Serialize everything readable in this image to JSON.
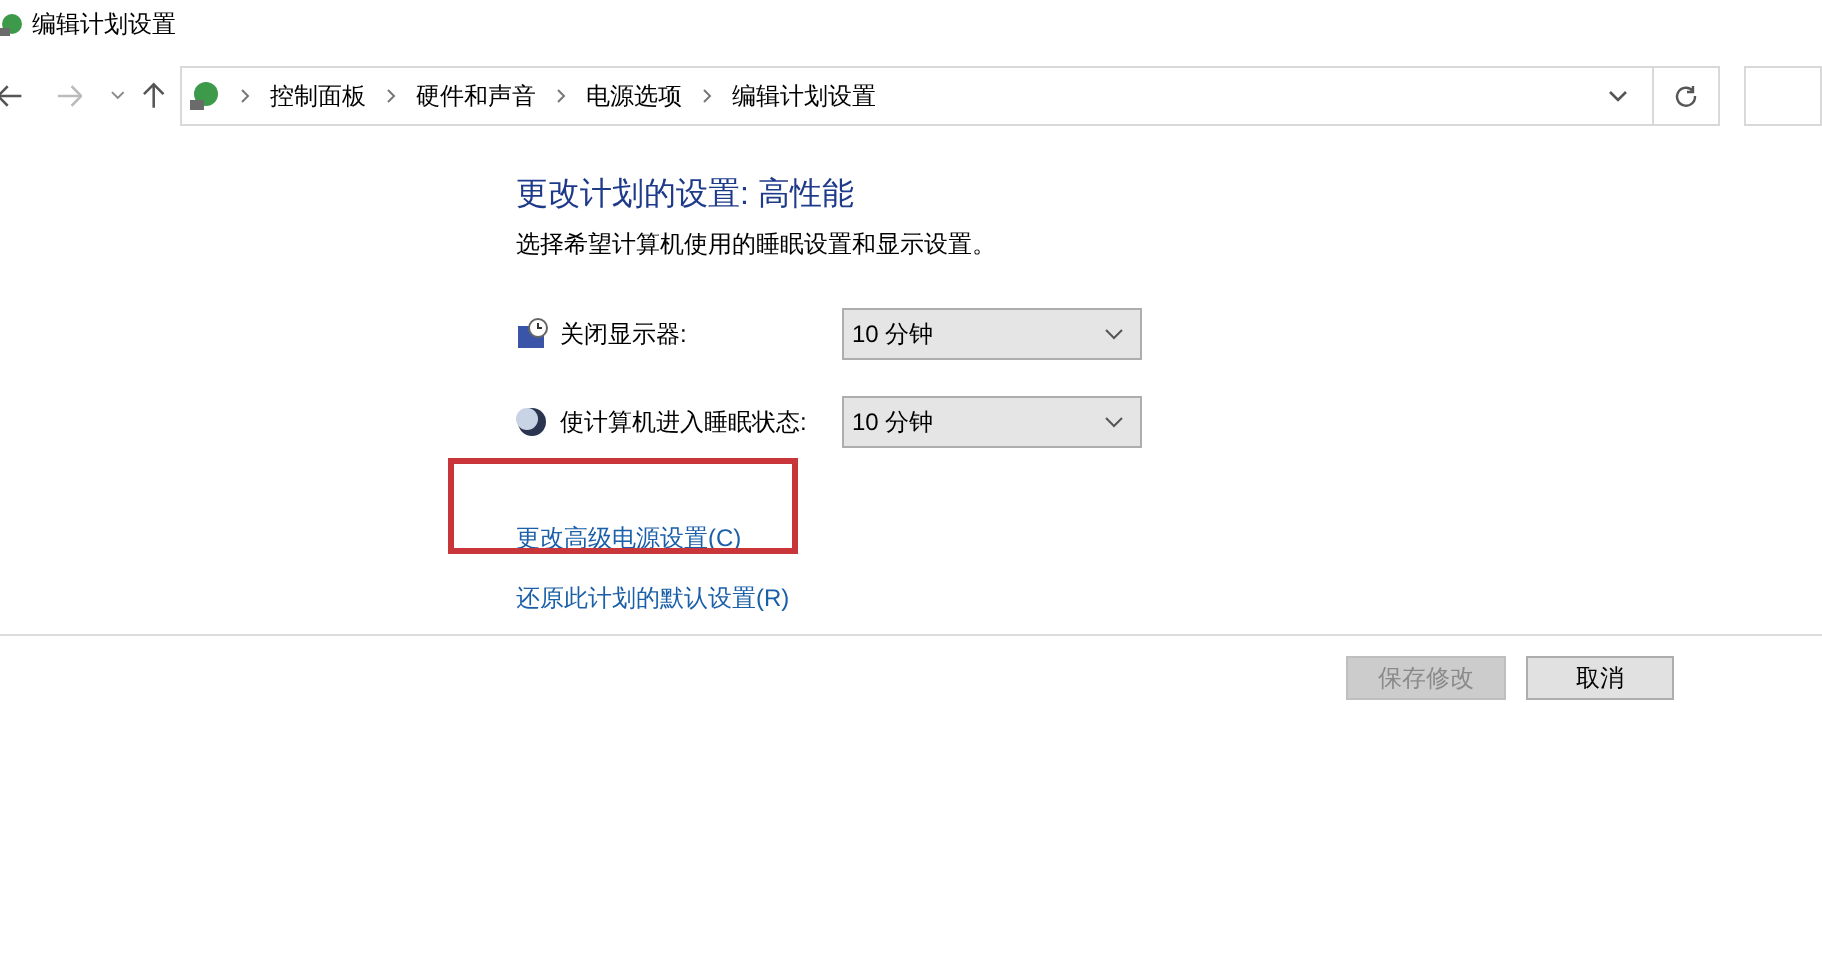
{
  "window": {
    "title": "编辑计划设置"
  },
  "breadcrumb": [
    "控制面板",
    "硬件和声音",
    "电源选项",
    "编辑计划设置"
  ],
  "heading": "更改计划的设置: 高性能",
  "subtitle": "选择希望计算机使用的睡眠设置和显示设置。",
  "settings": [
    {
      "kind": "display",
      "label": "关闭显示器:",
      "value": "10 分钟"
    },
    {
      "kind": "sleep",
      "label": "使计算机进入睡眠状态:",
      "value": "10 分钟"
    }
  ],
  "links": [
    {
      "label": "更改高级电源设置(C)",
      "highlighted": true
    },
    {
      "label": "还原此计划的默认设置(R)",
      "highlighted": false
    }
  ],
  "buttons": [
    {
      "label": "保存修改",
      "disabled": true
    },
    {
      "label": "取消",
      "disabled": false
    }
  ]
}
